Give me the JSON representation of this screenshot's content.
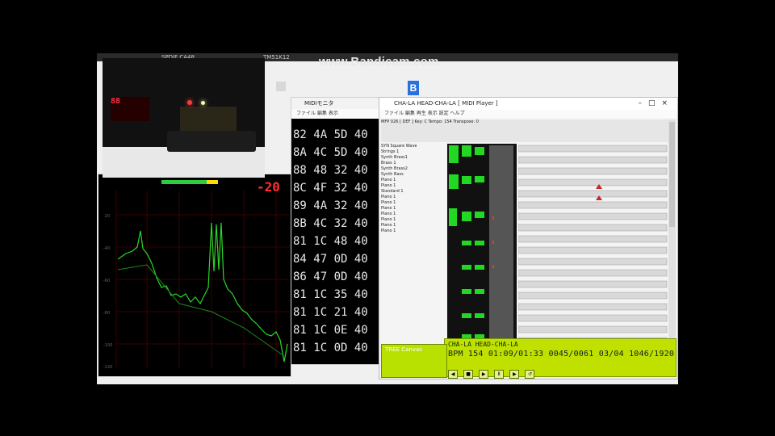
{
  "watermark": "www.Bandicam.com",
  "desktop": {
    "topbar": [
      "SPDIF CA48",
      "TM51K12"
    ]
  },
  "spectrum": {
    "db_readout": "-20",
    "y_ticks": [
      "-20",
      "-40",
      "-60",
      "-80",
      "-100",
      "-120"
    ]
  },
  "camera": {
    "display_text": "88"
  },
  "hex_window": {
    "title": "MIDIモニタ",
    "menu": "ファイル 編集 表示",
    "rows": [
      "82 4A 5D 40",
      "8A 4C 5D 40",
      "88 48 32 40",
      "8C 4F 32 40",
      "89 4A 32 40",
      "8B 4C 32 40",
      "81 1C 48 40",
      "84 47 0D 40",
      "86 47 0D 40",
      "81 1C 35 40",
      "81 1C 21 40",
      "81 1C 0E 40",
      "81 1C 0D 40"
    ]
  },
  "sequencer": {
    "title": "CHA-LA HEAD-CHA-LA [ MIDI Player ]",
    "menu": "ファイル 編集 再生 表示 設定 ヘルプ",
    "info_line": "MFP 026 [ DEF ] Key: C  Tempo: 154  Transpose: 0",
    "channels": [
      {
        "label": "SYN  Square  Wave"
      },
      {
        "label": "Strings 1"
      },
      {
        "label": "Synth Brass1"
      },
      {
        "label": "Brass 1"
      },
      {
        "label": "Synth Brass2"
      },
      {
        "label": "Synth Bass"
      },
      {
        "label": "Piano 1"
      },
      {
        "label": "Piano 1"
      },
      {
        "label": "Standard 1"
      },
      {
        "label": "Piano 1"
      },
      {
        "label": "Piano 1"
      },
      {
        "label": "Piano 1"
      },
      {
        "label": "Piano 1"
      },
      {
        "label": "Piano 1"
      },
      {
        "label": "Piano 1"
      },
      {
        "label": "Piano 1"
      }
    ],
    "pane_label": "TREE Canvas",
    "song_name": "CHA-LA HEAD-CHA-LA",
    "bpm_label": "BPM",
    "bpm": "154",
    "time": "01:09/01:33",
    "measure": "0045/0061",
    "beat": "03/04",
    "ticks": "1046/1920"
  }
}
